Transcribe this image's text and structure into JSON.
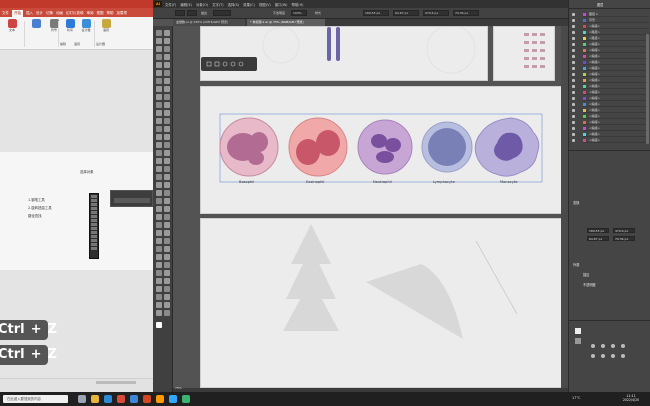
{
  "left_app": {
    "ribbon_tabs": [
      "文件",
      "开始",
      "插入",
      "设计",
      "切换",
      "动画",
      "幻灯片放映",
      "审阅",
      "视图",
      "帮助",
      "加载项"
    ],
    "ribbon_groups": [
      {
        "label": "文本",
        "color": "#c44"
      },
      {
        "label": "",
        "color": "#4a7fd1"
      },
      {
        "label": "符号",
        "color": "#7a7a7a"
      },
      {
        "label": "听写",
        "color": "#2d7bd8"
      },
      {
        "label": "设计器",
        "color": "#3a8fd8"
      },
      {
        "label": "语音",
        "color": "#c8a83c"
      }
    ],
    "group_captions": [
      "编辑",
      "语音",
      "设计器"
    ],
    "doc_title": "选择对象",
    "doc_lines": [
      "1.钢笔工具",
      "2.旋转扭曲工具",
      "路径查找"
    ],
    "shortcuts": [
      {
        "key": "Ctrl",
        "plus": "+",
        "letter": "Z"
      },
      {
        "key": "Ctrl",
        "plus": "+",
        "letter": "Z"
      }
    ]
  },
  "illustrator": {
    "logo": "Ai",
    "menus": [
      "文件(F)",
      "编辑(E)",
      "对象(O)",
      "文字(T)",
      "选择(S)",
      "效果(C)",
      "视图(V)",
      "窗口(W)",
      "帮助(H)"
    ],
    "workspace_label": "传统基本功能",
    "control_bar": {
      "stroke_label": "描边",
      "opacity_label": "不透明度",
      "opacity_value": "100%",
      "style_label": "样式",
      "x_value": "189.55 px",
      "y_value": "64.67 px",
      "w_value": "479.6 px",
      "h_value": "79.39 px"
    },
    "doc_tabs": [
      "血细胞.ai @ 150% (CMYK/GPU 预览)",
      "* 未标题-1.ai @ 75% (RGB/GPU 预览)"
    ],
    "cell_labels": [
      "Basophil",
      "Eosinophil",
      "Neutrophil",
      "Lymphocyte",
      "Monocyte"
    ],
    "zoom_status": "75%",
    "right_panel": {
      "title": "图层",
      "layers": [
        {
          "name": "图层 1",
          "color": "#c04ad8"
        },
        {
          "name": "背景",
          "color": "#4a6fd8"
        },
        {
          "name": "<编组>",
          "color": "#d84a4a"
        },
        {
          "name": "<路径>",
          "color": "#4ad8c9"
        },
        {
          "name": "<路径>",
          "color": "#d8d84a"
        },
        {
          "name": "<编组>",
          "color": "#4ad86f"
        },
        {
          "name": "<编组>",
          "color": "#d87a4a"
        },
        {
          "name": "<编组>",
          "color": "#d84aa5"
        },
        {
          "name": "<编组>",
          "color": "#6f4ad8"
        },
        {
          "name": "<编组>",
          "color": "#4aa5d8"
        },
        {
          "name": "<编组>",
          "color": "#a5d84a"
        },
        {
          "name": "<编组>",
          "color": "#d8a54a"
        },
        {
          "name": "<编组>",
          "color": "#4ad8a5"
        },
        {
          "name": "<编组>",
          "color": "#d84a6f"
        },
        {
          "name": "<编组>",
          "color": "#8a4ad8"
        },
        {
          "name": "<编组>",
          "color": "#4a8ad8"
        },
        {
          "name": "<编组>",
          "color": "#d8c04a"
        },
        {
          "name": "<编组>",
          "color": "#4ad84a"
        },
        {
          "name": "<编组>",
          "color": "#d86f4a"
        },
        {
          "name": "<编组>",
          "color": "#c94ad8"
        },
        {
          "name": "<编组>",
          "color": "#4ad8d8"
        },
        {
          "name": "<编组>",
          "color": "#d84a8a"
        }
      ],
      "transform_label": "变换",
      "appearance_label": "外观",
      "stroke_label": "描边",
      "opacity_label": "不透明度",
      "x_field": "189.55 px",
      "y_field": "64.67 px",
      "w_field": "479.6 px",
      "h_field": "79.39 px"
    }
  },
  "taskbar": {
    "search_placeholder": "在此键入要搜索的内容",
    "temperature": "17°C",
    "time": "11:11",
    "date": "2022/4/20",
    "icons": [
      {
        "name": "task-view-icon",
        "color": "#9aa6b6"
      },
      {
        "name": "explorer-icon",
        "color": "#e8b43a"
      },
      {
        "name": "edge-icon",
        "color": "#2e8ad6"
      },
      {
        "name": "chrome-icon",
        "color": "#d84a3a"
      },
      {
        "name": "store-icon",
        "color": "#3f86d6"
      },
      {
        "name": "powerpoint-icon",
        "color": "#d24726"
      },
      {
        "name": "illustrator-icon",
        "color": "#ff9a00"
      },
      {
        "name": "photoshop-icon",
        "color": "#31a8ff"
      },
      {
        "name": "wechat-icon",
        "color": "#3cb371"
      }
    ]
  }
}
